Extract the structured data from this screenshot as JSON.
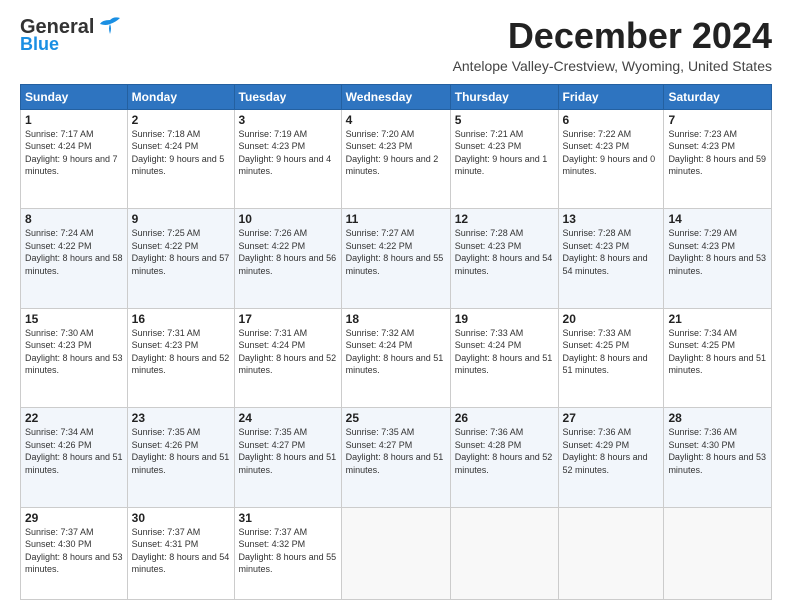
{
  "header": {
    "logo_line1": "General",
    "logo_line2": "Blue",
    "month_title": "December 2024",
    "subtitle": "Antelope Valley-Crestview, Wyoming, United States"
  },
  "days_of_week": [
    "Sunday",
    "Monday",
    "Tuesday",
    "Wednesday",
    "Thursday",
    "Friday",
    "Saturday"
  ],
  "weeks": [
    [
      {
        "day": "1",
        "sunrise": "7:17 AM",
        "sunset": "4:24 PM",
        "daylight": "9 hours and 7 minutes."
      },
      {
        "day": "2",
        "sunrise": "7:18 AM",
        "sunset": "4:24 PM",
        "daylight": "9 hours and 5 minutes."
      },
      {
        "day": "3",
        "sunrise": "7:19 AM",
        "sunset": "4:23 PM",
        "daylight": "9 hours and 4 minutes."
      },
      {
        "day": "4",
        "sunrise": "7:20 AM",
        "sunset": "4:23 PM",
        "daylight": "9 hours and 2 minutes."
      },
      {
        "day": "5",
        "sunrise": "7:21 AM",
        "sunset": "4:23 PM",
        "daylight": "9 hours and 1 minute."
      },
      {
        "day": "6",
        "sunrise": "7:22 AM",
        "sunset": "4:23 PM",
        "daylight": "9 hours and 0 minutes."
      },
      {
        "day": "7",
        "sunrise": "7:23 AM",
        "sunset": "4:23 PM",
        "daylight": "8 hours and 59 minutes."
      }
    ],
    [
      {
        "day": "8",
        "sunrise": "7:24 AM",
        "sunset": "4:22 PM",
        "daylight": "8 hours and 58 minutes."
      },
      {
        "day": "9",
        "sunrise": "7:25 AM",
        "sunset": "4:22 PM",
        "daylight": "8 hours and 57 minutes."
      },
      {
        "day": "10",
        "sunrise": "7:26 AM",
        "sunset": "4:22 PM",
        "daylight": "8 hours and 56 minutes."
      },
      {
        "day": "11",
        "sunrise": "7:27 AM",
        "sunset": "4:22 PM",
        "daylight": "8 hours and 55 minutes."
      },
      {
        "day": "12",
        "sunrise": "7:28 AM",
        "sunset": "4:23 PM",
        "daylight": "8 hours and 54 minutes."
      },
      {
        "day": "13",
        "sunrise": "7:28 AM",
        "sunset": "4:23 PM",
        "daylight": "8 hours and 54 minutes."
      },
      {
        "day": "14",
        "sunrise": "7:29 AM",
        "sunset": "4:23 PM",
        "daylight": "8 hours and 53 minutes."
      }
    ],
    [
      {
        "day": "15",
        "sunrise": "7:30 AM",
        "sunset": "4:23 PM",
        "daylight": "8 hours and 53 minutes."
      },
      {
        "day": "16",
        "sunrise": "7:31 AM",
        "sunset": "4:23 PM",
        "daylight": "8 hours and 52 minutes."
      },
      {
        "day": "17",
        "sunrise": "7:31 AM",
        "sunset": "4:24 PM",
        "daylight": "8 hours and 52 minutes."
      },
      {
        "day": "18",
        "sunrise": "7:32 AM",
        "sunset": "4:24 PM",
        "daylight": "8 hours and 51 minutes."
      },
      {
        "day": "19",
        "sunrise": "7:33 AM",
        "sunset": "4:24 PM",
        "daylight": "8 hours and 51 minutes."
      },
      {
        "day": "20",
        "sunrise": "7:33 AM",
        "sunset": "4:25 PM",
        "daylight": "8 hours and 51 minutes."
      },
      {
        "day": "21",
        "sunrise": "7:34 AM",
        "sunset": "4:25 PM",
        "daylight": "8 hours and 51 minutes."
      }
    ],
    [
      {
        "day": "22",
        "sunrise": "7:34 AM",
        "sunset": "4:26 PM",
        "daylight": "8 hours and 51 minutes."
      },
      {
        "day": "23",
        "sunrise": "7:35 AM",
        "sunset": "4:26 PM",
        "daylight": "8 hours and 51 minutes."
      },
      {
        "day": "24",
        "sunrise": "7:35 AM",
        "sunset": "4:27 PM",
        "daylight": "8 hours and 51 minutes."
      },
      {
        "day": "25",
        "sunrise": "7:35 AM",
        "sunset": "4:27 PM",
        "daylight": "8 hours and 51 minutes."
      },
      {
        "day": "26",
        "sunrise": "7:36 AM",
        "sunset": "4:28 PM",
        "daylight": "8 hours and 52 minutes."
      },
      {
        "day": "27",
        "sunrise": "7:36 AM",
        "sunset": "4:29 PM",
        "daylight": "8 hours and 52 minutes."
      },
      {
        "day": "28",
        "sunrise": "7:36 AM",
        "sunset": "4:30 PM",
        "daylight": "8 hours and 53 minutes."
      }
    ],
    [
      {
        "day": "29",
        "sunrise": "7:37 AM",
        "sunset": "4:30 PM",
        "daylight": "8 hours and 53 minutes."
      },
      {
        "day": "30",
        "sunrise": "7:37 AM",
        "sunset": "4:31 PM",
        "daylight": "8 hours and 54 minutes."
      },
      {
        "day": "31",
        "sunrise": "7:37 AM",
        "sunset": "4:32 PM",
        "daylight": "8 hours and 55 minutes."
      },
      null,
      null,
      null,
      null
    ]
  ],
  "labels": {
    "sunrise": "Sunrise:",
    "sunset": "Sunset:",
    "daylight": "Daylight:"
  }
}
